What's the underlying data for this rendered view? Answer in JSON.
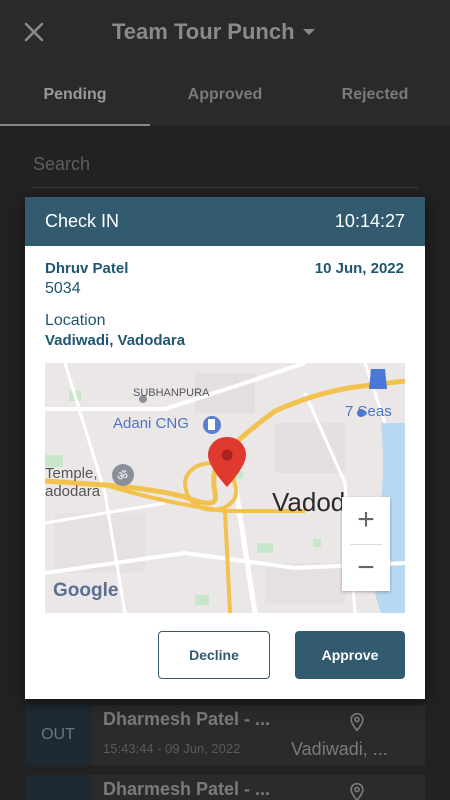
{
  "app": {
    "title": "Team Tour Punch"
  },
  "icons": {
    "close": "close-icon",
    "dropdown": "caret-down-icon",
    "location": "location-pin-icon"
  },
  "tabs": [
    {
      "label": "Pending",
      "active": true
    },
    {
      "label": "Approved",
      "active": false
    },
    {
      "label": "Rejected",
      "active": false
    }
  ],
  "search": {
    "placeholder": "Search",
    "value": ""
  },
  "list": [
    {
      "type": "OUT",
      "name": "Dharmesh Patel - ...",
      "datetime": "15:43:44 - 09 Jun, 2022",
      "location": "Vadiwadi, ..."
    },
    {
      "type": "",
      "name": "Dharmesh Patel - ...",
      "datetime": "",
      "location": ""
    }
  ],
  "dialog": {
    "header_left": "Check IN",
    "header_right": "10:14:27",
    "employee_name": "Dhruv Patel",
    "employee_id": "5034",
    "date": "10 Jun, 2022",
    "location_label": "Location",
    "location_value": "Vadiwadi, Vadodara",
    "map": {
      "labels": {
        "subhanpura": "SUBHANPURA",
        "adani": "Adani CNG",
        "seas": "7 Seas",
        "temple": "Temple,",
        "temple2": "adodara",
        "city": "Vadodara",
        "google": "Google"
      },
      "zoom_in": "+",
      "zoom_out": "−"
    },
    "decline_label": "Decline",
    "approve_label": "Approve"
  },
  "colors": {
    "primary": "#325b6f",
    "accent_text": "#1f5772",
    "marker": "#e03a2f"
  }
}
